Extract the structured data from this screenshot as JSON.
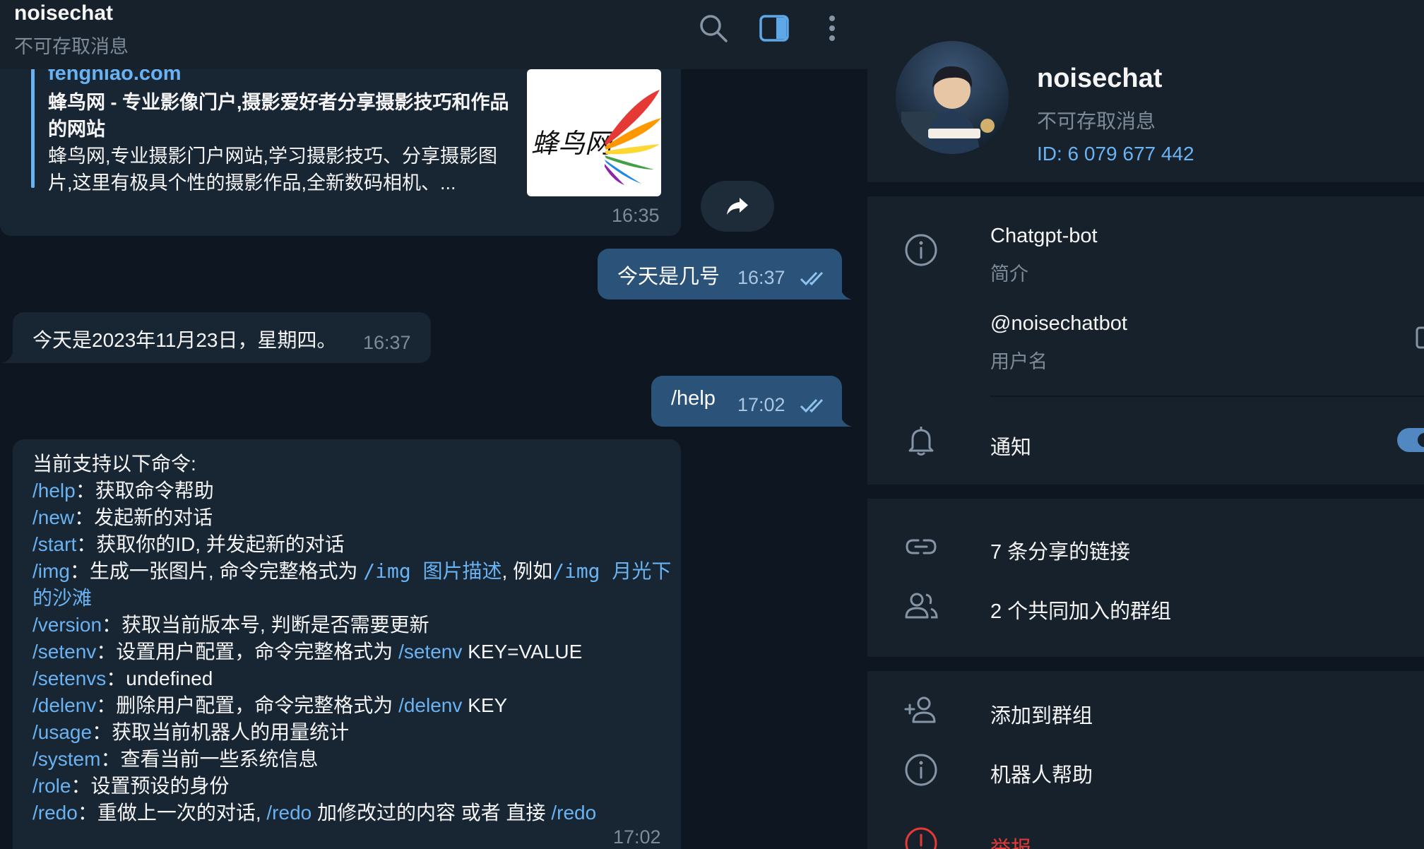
{
  "chat": {
    "title": "noisechat",
    "subtitle": "不可存取消息",
    "preview": {
      "site": "fengniao.com",
      "title": "蜂鸟网 - 专业影像门户,摄影爱好者分享摄影技巧和作品的网站",
      "description": "蜂鸟网,专业摄影门户网站,学习摄影技巧、分享摄影图片,这里有极具个性的摄影作品,全新数码相机、...",
      "image_text": "蜂鸟网",
      "time": "16:35"
    },
    "messages": [
      {
        "text": "今天是几号",
        "time": "16:37"
      },
      {
        "text": "今天是2023年11月23日，星期四。",
        "time": "16:37"
      },
      {
        "text": "/help",
        "time": "17:02"
      }
    ],
    "help": {
      "intro": "当前支持以下命令:",
      "lines": [
        {
          "cmd": "/help",
          "desc": "：获取命令帮助"
        },
        {
          "cmd": "/new",
          "desc": "：发起新的对话"
        },
        {
          "cmd": "/start",
          "desc": "：获取你的ID, 并发起新的对话"
        },
        {
          "cmd": "/img",
          "desc": "：生成一张图片, 命令完整格式为 ",
          "code1": "/img 图片描述",
          "mid": ", 例如",
          "code2": "/img 月光下的沙滩"
        },
        {
          "cmd": "/version",
          "desc": "：获取当前版本号, 判断是否需要更新"
        },
        {
          "cmd": "/setenv",
          "desc": "：设置用户配置，命令完整格式为 ",
          "cmd2": "/setenv",
          "tail": " KEY=VALUE"
        },
        {
          "cmd": "/setenvs",
          "desc": "：undefined"
        },
        {
          "cmd": "/delenv",
          "desc": "：删除用户配置，命令完整格式为 ",
          "cmd2": "/delenv",
          "tail": " KEY"
        },
        {
          "cmd": "/usage",
          "desc": "：获取当前机器人的用量统计"
        },
        {
          "cmd": "/system",
          "desc": "：查看当前一些系统信息"
        },
        {
          "cmd": "/role",
          "desc": "：设置预设的身份"
        },
        {
          "cmd": "/redo",
          "desc": "：重做上一次的对话, ",
          "cmd2": "/redo",
          "tail": " 加修改过的内容 或者 直接 ",
          "cmd3": "/redo"
        }
      ],
      "time": "17:02"
    }
  },
  "profile": {
    "name": "noisechat",
    "status": "不可存取消息",
    "id": "ID: 6 079 677 442",
    "bio": "Chatgpt-bot",
    "bio_label": "简介",
    "username": "@noisechatbot",
    "username_label": "用户名",
    "notifications_label": "通知",
    "notifications_on": true,
    "shared_links": "7 条分享的链接",
    "common_groups": "2 个共同加入的群组",
    "add_to_group": "添加到群组",
    "bot_help": "机器人帮助",
    "report": "举报"
  },
  "colors": {
    "accent": "#6ab3f3",
    "outgoing_bubble": "#2b5278",
    "incoming_bubble": "#182533",
    "danger": "#e53935"
  }
}
